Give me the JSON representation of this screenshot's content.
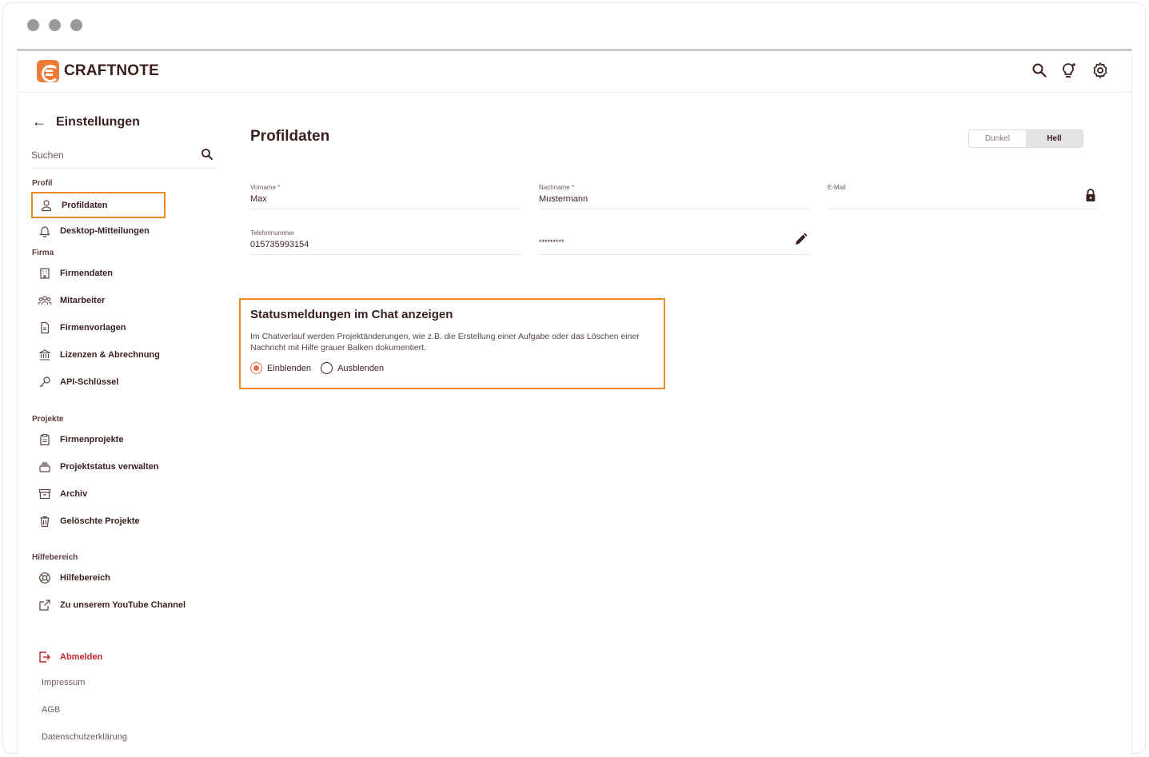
{
  "app": {
    "logo_text": "CRAFTNOTE",
    "accent_color": "#f07a3a"
  },
  "sidebar": {
    "title": "Einstellungen",
    "search_placeholder": "Suchen",
    "sections": {
      "profil": "Profil",
      "firma": "Firma",
      "projekte": "Projekte",
      "hilfe": "Hilfebereich"
    },
    "items": [
      {
        "label": "Profildaten",
        "icon": "user-icon"
      },
      {
        "label": "Desktop-Mitteilungen",
        "icon": "bell-icon"
      },
      {
        "label": "Firmendaten",
        "icon": "building-icon"
      },
      {
        "label": "Mitarbeiter",
        "icon": "team-icon"
      },
      {
        "label": "Firmenvorlagen",
        "icon": "document-icon"
      },
      {
        "label": "Lizenzen & Abrechnung",
        "icon": "bank-icon"
      },
      {
        "label": "API-Schlüssel",
        "icon": "key-icon"
      },
      {
        "label": "Firmenprojekte",
        "icon": "clipboard-icon"
      },
      {
        "label": "Projektstatus verwalten",
        "icon": "stack-icon"
      },
      {
        "label": "Archiv",
        "icon": "archive-icon"
      },
      {
        "label": "Gelöschte Projekte",
        "icon": "trash-icon"
      },
      {
        "label": "Hilfebereich",
        "icon": "lifebuoy-icon"
      },
      {
        "label": "Zu unserem YouTube Channel",
        "icon": "external-link-icon"
      }
    ],
    "logout": "Abmelden",
    "links": [
      "Impressum",
      "AGB",
      "Datenschutzerklärung"
    ]
  },
  "main": {
    "title": "Profildaten",
    "theme": {
      "dark": "Dunkel",
      "light": "Hell",
      "selected": "Hell"
    },
    "fields": {
      "firstname": {
        "label": "Vorname *",
        "value": "Max"
      },
      "lastname": {
        "label": "Nachname *",
        "value": "Mustermann"
      },
      "email": {
        "label": "E-Mail",
        "value": ""
      },
      "phone": {
        "label": "Telefonnummer",
        "value": "015735993154"
      },
      "password": {
        "value": "*********"
      }
    },
    "status": {
      "title": "Statusmeldungen im Chat anzeigen",
      "description": "Im Chatverlauf werden Projektänderungen, wie z.B. die Erstellung einer Aufgabe oder das Löschen einer Nachricht mit Hilfe grauer Balken dokumentiert.",
      "options": [
        "Einblenden",
        "Ausblenden"
      ],
      "selected": "Einblenden"
    }
  }
}
